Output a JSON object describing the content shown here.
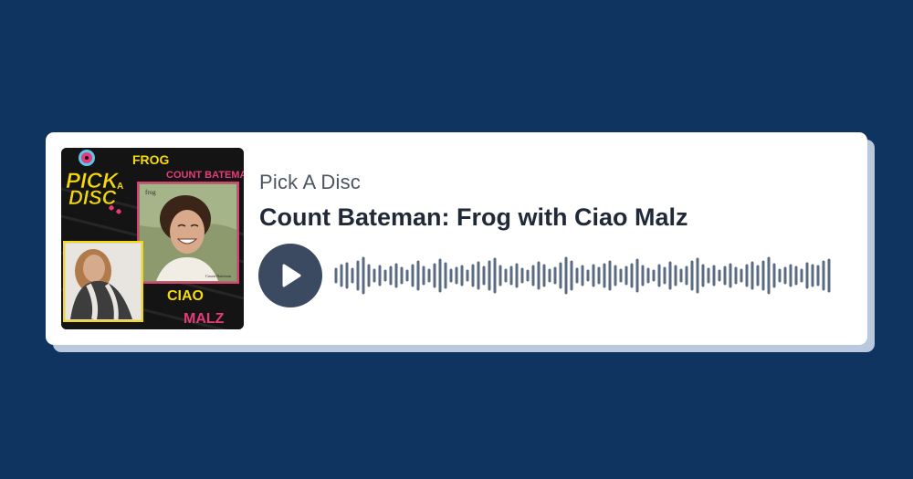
{
  "player": {
    "show_name": "Pick A Disc",
    "episode_title": "Count Bateman: Frog with Ciao Malz"
  },
  "cover_art": {
    "logo_line1": "PICK",
    "logo_a": "A",
    "logo_line2": "DISC",
    "word_frog": "FROG",
    "word_count_bateman": "COUNT BATEMAN",
    "word_ciao": "CIAO",
    "word_malz": "MALZ",
    "album_title": "frog",
    "album_artist": "Count Bateman"
  },
  "waveform": {
    "bar_heights": [
      14,
      22,
      26,
      14,
      30,
      38,
      22,
      12,
      20,
      10,
      18,
      24,
      16,
      10,
      22,
      30,
      18,
      12,
      24,
      34,
      26,
      12,
      16,
      20,
      10,
      22,
      28,
      18,
      30,
      36,
      20,
      12,
      18,
      24,
      14,
      10,
      20,
      28,
      22,
      12,
      16,
      26,
      38,
      30,
      14,
      20,
      10,
      22,
      16,
      24,
      30,
      20,
      12,
      18,
      24,
      34,
      20,
      14,
      10,
      22,
      16,
      28,
      20,
      12,
      18,
      30,
      36,
      22,
      14,
      20,
      10,
      18,
      24,
      16,
      12,
      22,
      28,
      20,
      30,
      38,
      24,
      12,
      16,
      22,
      18,
      12,
      26,
      22,
      20,
      30,
      34
    ]
  },
  "colors": {
    "background": "#0f3460",
    "card": "#ffffff",
    "play_button": "#3b4a61",
    "waveform": "#5b6b82",
    "logo_yellow": "#f5d90a",
    "logo_pink": "#e63b7a"
  }
}
